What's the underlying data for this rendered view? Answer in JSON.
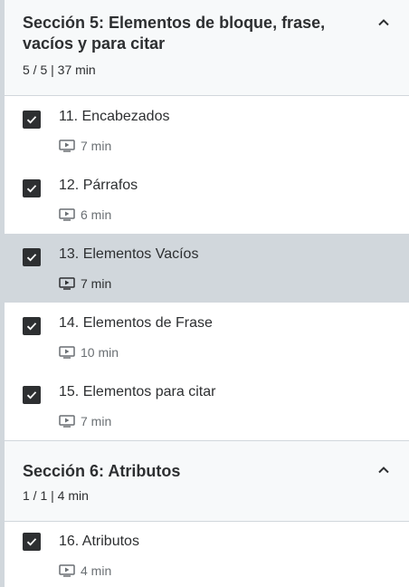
{
  "sections": [
    {
      "title": "Sección 5: Elementos de bloque, frase, vacíos y para citar",
      "meta": "5 / 5 | 37 min",
      "lectures": [
        {
          "title": "11. Encabezados",
          "duration": "7 min",
          "completed": true,
          "active": false
        },
        {
          "title": "12. Párrafos",
          "duration": "6 min",
          "completed": true,
          "active": false
        },
        {
          "title": "13. Elementos Vacíos",
          "duration": "7 min",
          "completed": true,
          "active": true
        },
        {
          "title": "14. Elementos de Frase",
          "duration": "10 min",
          "completed": true,
          "active": false
        },
        {
          "title": "15. Elementos para citar",
          "duration": "7 min",
          "completed": true,
          "active": false
        }
      ]
    },
    {
      "title": "Sección 6: Atributos",
      "meta": "1 / 1 | 4 min",
      "lectures": [
        {
          "title": "16. Atributos",
          "duration": "4 min",
          "completed": true,
          "active": false
        }
      ]
    }
  ],
  "icons": {
    "collapse": "chevron-up-icon",
    "check": "check-icon",
    "video": "video-icon"
  },
  "colors": {
    "active_row": "#d1d7dc",
    "header_bg": "#f7f9fa",
    "checkbox": "#2d2f31"
  }
}
